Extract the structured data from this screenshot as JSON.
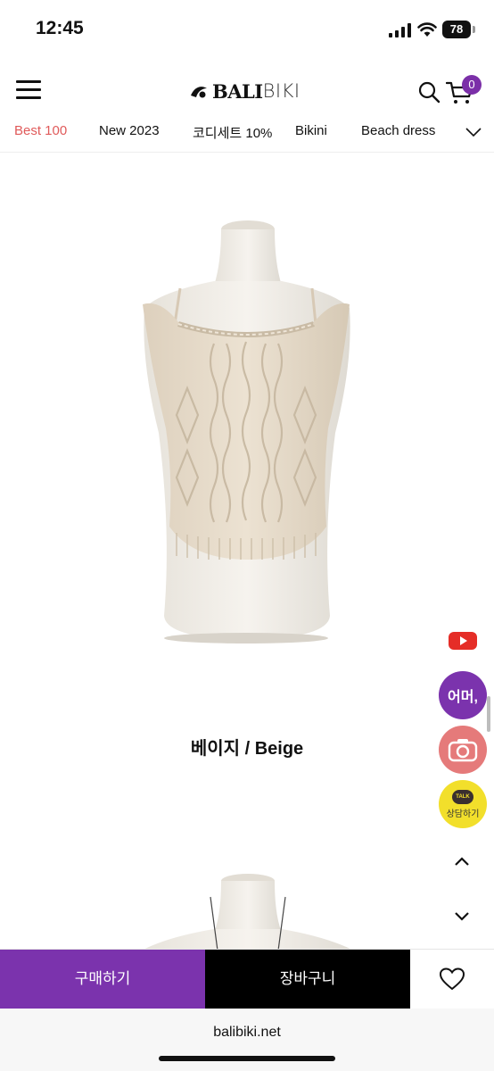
{
  "status": {
    "time": "12:45",
    "battery": "78"
  },
  "header": {
    "logo_main": "BALI",
    "logo_sub": "BIKI",
    "cart_count": "0"
  },
  "categories": [
    {
      "label": "Best 100",
      "active": true
    },
    {
      "label": "New 2023"
    },
    {
      "label": "코디세트 10%"
    },
    {
      "label": "Bikini"
    },
    {
      "label": "Beach dress"
    }
  ],
  "product": {
    "color_caption": "베이지 / Beige"
  },
  "floating": {
    "eomeo_label": "어머,",
    "talk_badge": "TALK",
    "talk_label": "상담하기"
  },
  "actions": {
    "buy": "구매하기",
    "cart": "장바구니"
  },
  "browser": {
    "url": "balibiki.net"
  },
  "colors": {
    "accent": "#7b33ad",
    "active_category": "#e05a5a",
    "talk_yellow": "#f2df2b",
    "camera_pink": "#e57a7a",
    "knit_beige": "#e8dccb"
  }
}
